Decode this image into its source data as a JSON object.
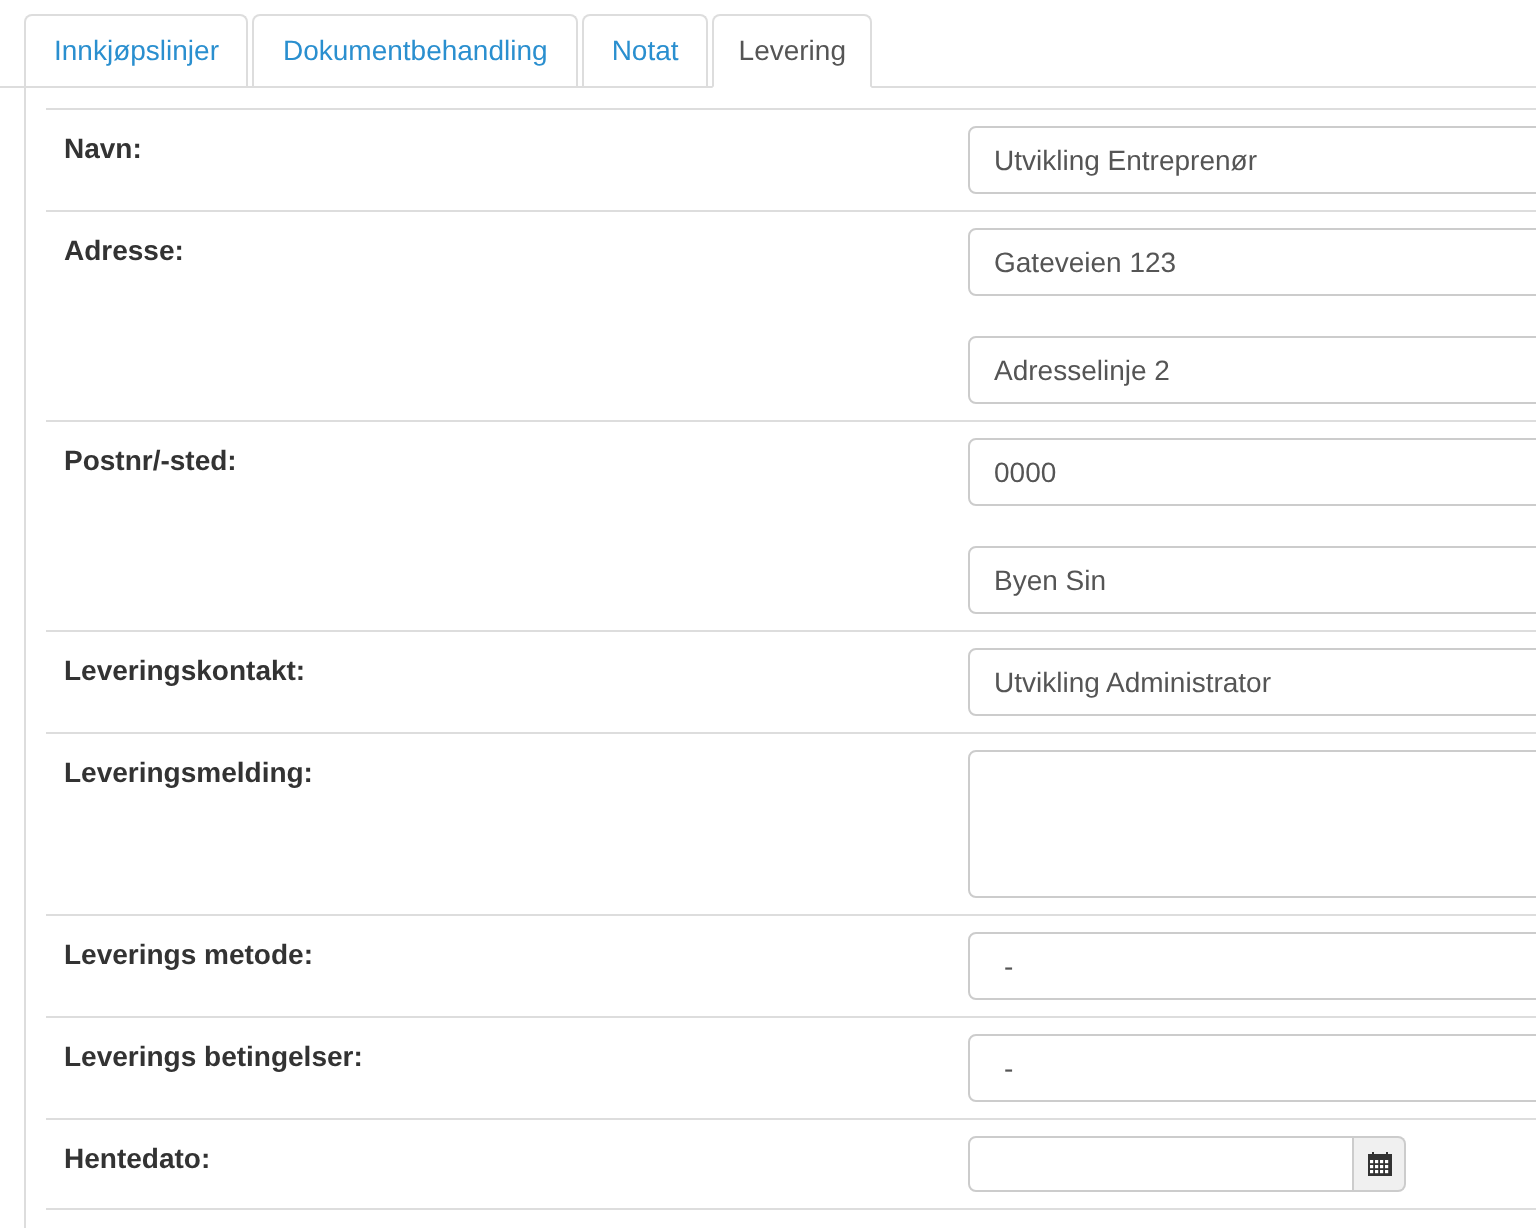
{
  "tabs": [
    {
      "label": "Innkjøpslinjer",
      "selected": false
    },
    {
      "label": "Dokumentbehandling",
      "selected": false
    },
    {
      "label": "Notat",
      "selected": false
    },
    {
      "label": "Levering",
      "selected": true
    }
  ],
  "rows": [
    {
      "label": "Navn:",
      "fields": [
        {
          "kind": "text",
          "value": "Utvikling Entreprenør"
        }
      ]
    },
    {
      "label": "Adresse:",
      "fields": [
        {
          "kind": "text",
          "value": "Gateveien 123"
        },
        {
          "kind": "text",
          "value": "Adresselinje 2"
        }
      ]
    },
    {
      "label": "Postnr/-sted:",
      "fields": [
        {
          "kind": "text",
          "value": "0000"
        },
        {
          "kind": "text",
          "value": "Byen Sin"
        }
      ]
    },
    {
      "label": "Leveringskontakt:",
      "fields": [
        {
          "kind": "text",
          "value": "Utvikling Administrator"
        }
      ]
    },
    {
      "label": "Leveringsmelding:",
      "fields": [
        {
          "kind": "textarea"
        }
      ]
    },
    {
      "label": "Leverings metode:",
      "fields": [
        {
          "kind": "select",
          "value": "-"
        }
      ]
    },
    {
      "label": "Leverings betingelser:",
      "fields": [
        {
          "kind": "select",
          "value": "-"
        }
      ]
    },
    {
      "label": "Hentedato:",
      "fields": [
        {
          "kind": "date"
        }
      ]
    }
  ]
}
